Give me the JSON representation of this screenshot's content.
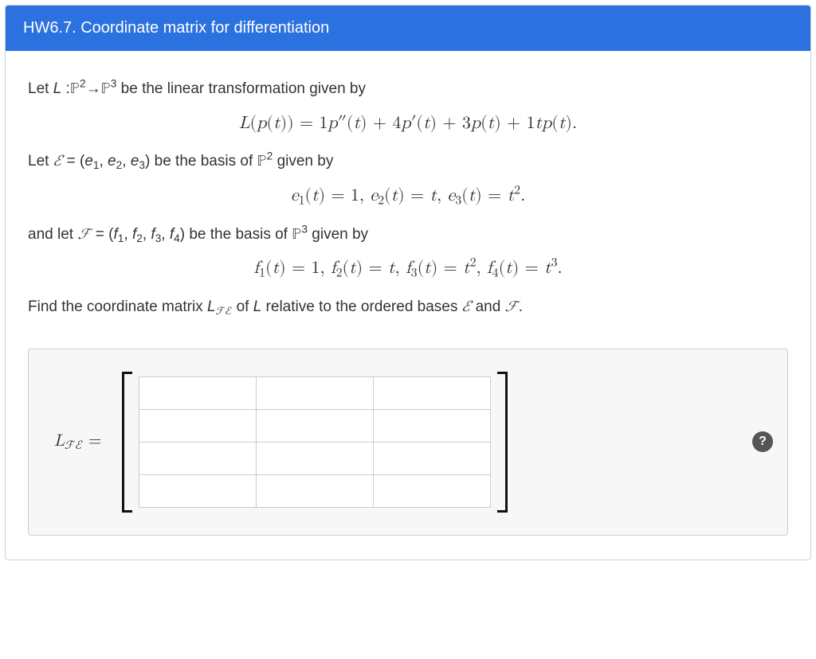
{
  "header": {
    "title": "HW6.7. Coordinate matrix for differentiation"
  },
  "body": {
    "line1_pre": "Let ",
    "line1_mid": " be the linear transformation given by",
    "mapping": "L : ℙ² → ℙ³",
    "eq_L": "L(p(t)) = 1p″(t) + 4p′(t) + 3p(t) + 1tp(t).",
    "line2_pre": "Let ",
    "line2_mid": " be the basis of ",
    "line2_post": " given by",
    "E_def": "ℰ = (e₁, e₂, e₃)",
    "P2": "ℙ²",
    "eq_E": "e₁(t) = 1, e₂(t) = t, e₃(t) = t².",
    "line3_pre": "and let ",
    "line3_mid": " be the basis of ",
    "line3_post": " given by",
    "F_def": "ℱ = (f₁, f₂, f₃, f₄)",
    "P3": "ℙ³",
    "eq_F": "f₁(t) = 1, f₂(t) = t, f₃(t) = t², f₄(t) = t³.",
    "line4_pre": "Find the coordinate matrix ",
    "line4_L": "L_{ℱℰ}",
    "line4_mid": " of ",
    "line4_L2": "L",
    "line4_mid2": " relative to the ordered bases ",
    "line4_and": " and ",
    "line4_end": "."
  },
  "answer": {
    "label": "L_{ℱℰ} =",
    "rows": 4,
    "cols": 3,
    "values": [
      [
        "",
        "",
        ""
      ],
      [
        "",
        "",
        ""
      ],
      [
        "",
        "",
        ""
      ],
      [
        "",
        "",
        ""
      ]
    ],
    "help_glyph": "?"
  }
}
